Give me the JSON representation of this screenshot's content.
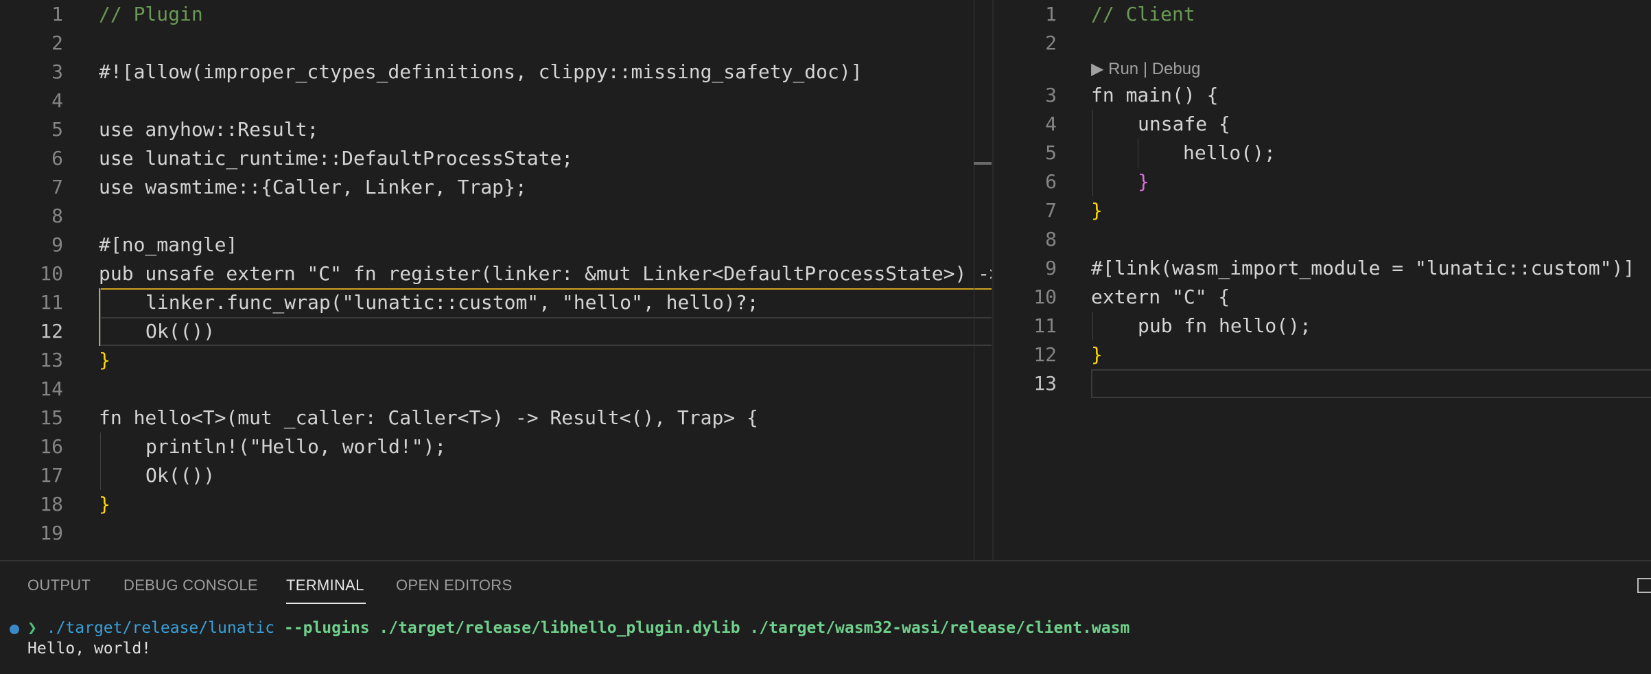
{
  "left_editor": {
    "line_numbers": [
      "1",
      "2",
      "3",
      "4",
      "5",
      "6",
      "7",
      "8",
      "9",
      "10",
      "11",
      "12",
      "13",
      "14",
      "15",
      "16",
      "17",
      "18",
      "19"
    ],
    "comment": "// Plugin",
    "attr_line": "#![allow(improper_ctypes_definitions, clippy::missing_safety_doc)]",
    "use_anyhow": "use anyhow::Result;",
    "use_lunatic": "use lunatic_runtime::DefaultProcessState;",
    "use_wasmtime": "use wasmtime::{Caller, Linker, Trap};",
    "no_mangle": "#[no_mangle]",
    "register_sig": "pub unsafe extern \"C\" fn register(linker: &mut Linker<DefaultProcessState>) ->",
    "func_wrap": "linker.func_wrap(\"lunatic::custom\", \"hello\", hello)?;",
    "ok_unit": "Ok(())",
    "close_brace": "}",
    "hello_sig": "fn hello<T>(mut _caller: Caller<T>) -> Result<(), Trap> {",
    "println": "println!(\"Hello, world!\");"
  },
  "right_editor": {
    "line_numbers": [
      "1",
      "2",
      "3",
      "4",
      "5",
      "6",
      "7",
      "8",
      "9",
      "10",
      "11",
      "12",
      "13"
    ],
    "comment": "// Client",
    "codelens": "▶ Run | Debug",
    "main_sig": "fn main() {",
    "unsafe_block": "unsafe {",
    "hello_call": "hello();",
    "link_attr": "#[link(wasm_import_module = \"lunatic::custom\")]",
    "extern_block": "extern \"C\" {",
    "pub_fn": "pub fn hello();"
  },
  "panel": {
    "tabs": [
      "OUTPUT",
      "DEBUG CONSOLE",
      "TERMINAL",
      "OPEN EDITORS"
    ],
    "active_tab": "TERMINAL",
    "terminal": {
      "prompt": "❯",
      "command": "./target/release/lunatic",
      "args": "--plugins ./target/release/libhello_plugin.dylib ./target/wasm32-wasi/release/client.wasm",
      "output": "Hello, world!"
    }
  },
  "colors": {
    "background": "#1e1e1e",
    "keyword": "#569cd6",
    "type": "#4ec9b0",
    "function": "#dcdcaa",
    "string": "#ce9178",
    "comment": "#6a9955",
    "selection_border": "#d1a21f"
  }
}
